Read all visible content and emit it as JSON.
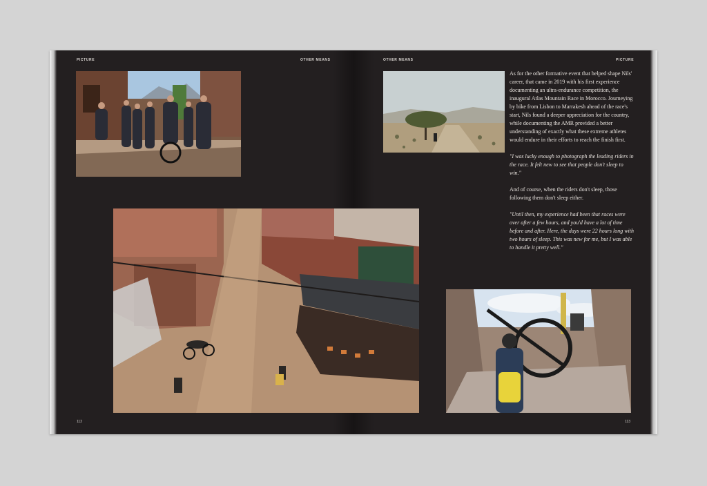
{
  "left_page": {
    "running_head_left": "PICTURE",
    "running_head_right": "OTHER MEANS",
    "folio": "112"
  },
  "right_page": {
    "running_head_left": "OTHER MEANS",
    "running_head_right": "PICTURE",
    "folio": "113",
    "paragraphs": [
      "As for the other formative event that helped shape Nils' career, that came in 2019 with his first experience documenting an ultra-endurance competition, the inaugural Atlas Mountain Race in Morocco. Journeying by bike from Lisbon to Marrakesh ahead of the race's start, Nils found a deeper appreciation for the country, while documenting the AMR provided a better understanding of exactly what these extreme athletes would endure in their efforts to reach the finish first.",
      "\"I was lucky enough to photograph the leading riders in the race. It felt new to see that people don't sleep to win.\"",
      "And of course, when the riders don't sleep, those following them don't sleep either.",
      "\"Until then, my experience had been that races were over after a few hours, and you'd have a lot of time before and after. Here, the days were 22 hours long with two hours of sleep. This was new for me, but I was able to handle it pretty well.\""
    ]
  }
}
